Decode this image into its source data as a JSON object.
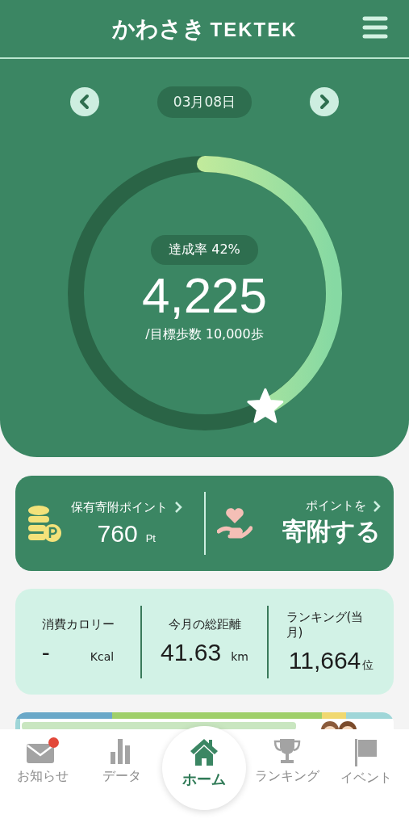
{
  "header": {
    "logo_kana": "かわさき",
    "logo_latin": "TEKTEK"
  },
  "date_nav": {
    "date": "03月08日"
  },
  "progress": {
    "level": 0.4225,
    "rate_label": "達成率 42%",
    "steps": "4,225",
    "goal": "/目標歩数 10,000歩"
  },
  "points": {
    "label": "保有寄附ポイント",
    "value": "760",
    "unit": "Pt",
    "donate_label": "ポイントを",
    "donate_action": "寄附する"
  },
  "stats": [
    {
      "label": "消費カロリー",
      "value": "-",
      "unit": "Kcal"
    },
    {
      "label": "今月の総距離",
      "value": "41.63",
      "unit": "km"
    },
    {
      "label": "ランキング(当月)",
      "value": "11,664",
      "unit": "位"
    }
  ],
  "nav": [
    {
      "kind": "mail",
      "label": "お知らせ",
      "selected": false,
      "badge": true
    },
    {
      "kind": "chart",
      "label": "データ",
      "selected": false,
      "badge": false
    },
    {
      "kind": "home",
      "label": "ホーム",
      "selected": true,
      "badge": false
    },
    {
      "kind": "trophy",
      "label": "ランキング",
      "selected": false,
      "badge": false
    },
    {
      "kind": "flag",
      "label": "イベント",
      "selected": false,
      "badge": false
    }
  ]
}
